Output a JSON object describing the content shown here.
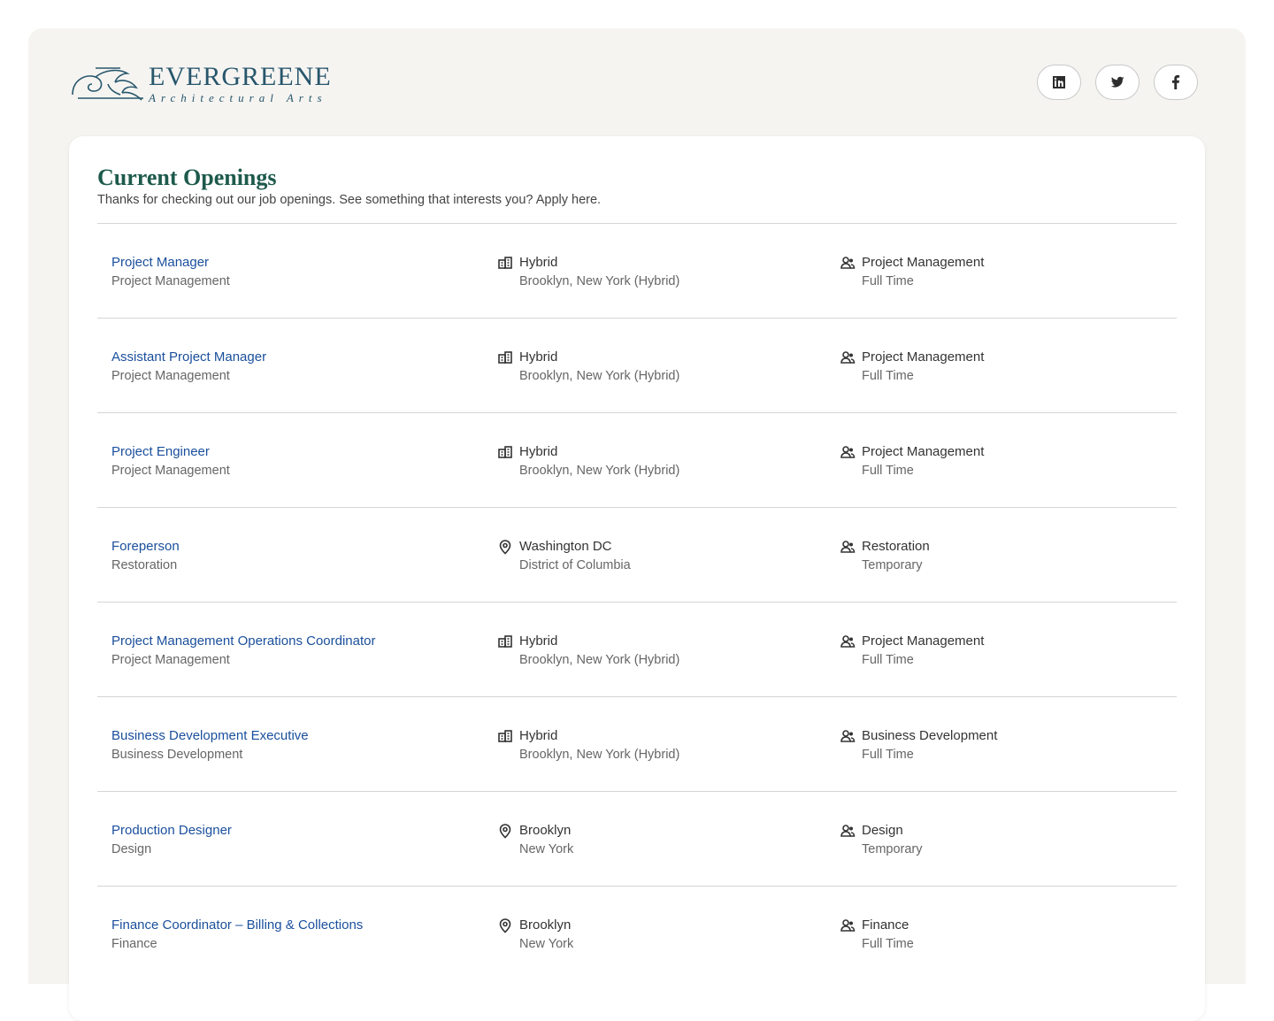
{
  "brand": {
    "name": "EVERGREENE",
    "subtitle": "Architectural Arts"
  },
  "socials": [
    {
      "icon": "linkedin-icon"
    },
    {
      "icon": "twitter-icon"
    },
    {
      "icon": "facebook-icon"
    }
  ],
  "openings": {
    "title": "Current Openings",
    "subtitle": "Thanks for checking out our job openings. See something that interests you? Apply here.",
    "jobs": [
      {
        "title": "Project Manager",
        "department": "Project Management",
        "location_type": "Hybrid",
        "location": "Brooklyn, New York (Hybrid)",
        "location_icon": "office-building-icon",
        "team": "Project Management",
        "employment": "Full Time"
      },
      {
        "title": "Assistant Project Manager",
        "department": "Project Management",
        "location_type": "Hybrid",
        "location": "Brooklyn, New York (Hybrid)",
        "location_icon": "office-building-icon",
        "team": "Project Management",
        "employment": "Full Time"
      },
      {
        "title": "Project Engineer",
        "department": "Project Management",
        "location_type": "Hybrid",
        "location": "Brooklyn, New York (Hybrid)",
        "location_icon": "office-building-icon",
        "team": "Project Management",
        "employment": "Full Time"
      },
      {
        "title": "Foreperson",
        "department": "Restoration",
        "location_type": "Washington DC",
        "location": "District of Columbia",
        "location_icon": "map-pin-icon",
        "team": "Restoration",
        "employment": "Temporary"
      },
      {
        "title": "Project Management Operations Coordinator",
        "department": "Project Management",
        "location_type": "Hybrid",
        "location": "Brooklyn, New York (Hybrid)",
        "location_icon": "office-building-icon",
        "team": "Project Management",
        "employment": "Full Time"
      },
      {
        "title": "Business Development Executive",
        "department": "Business Development",
        "location_type": "Hybrid",
        "location": "Brooklyn, New York (Hybrid)",
        "location_icon": "office-building-icon",
        "team": "Business Development",
        "employment": "Full Time"
      },
      {
        "title": "Production Designer",
        "department": "Design",
        "location_type": "Brooklyn",
        "location": "New York",
        "location_icon": "map-pin-icon",
        "team": "Design",
        "employment": "Temporary"
      },
      {
        "title": "Finance Coordinator – Billing & Collections",
        "department": "Finance",
        "location_type": "Brooklyn",
        "location": "New York",
        "location_icon": "map-pin-icon",
        "team": "Finance",
        "employment": "Full Time"
      }
    ]
  }
}
